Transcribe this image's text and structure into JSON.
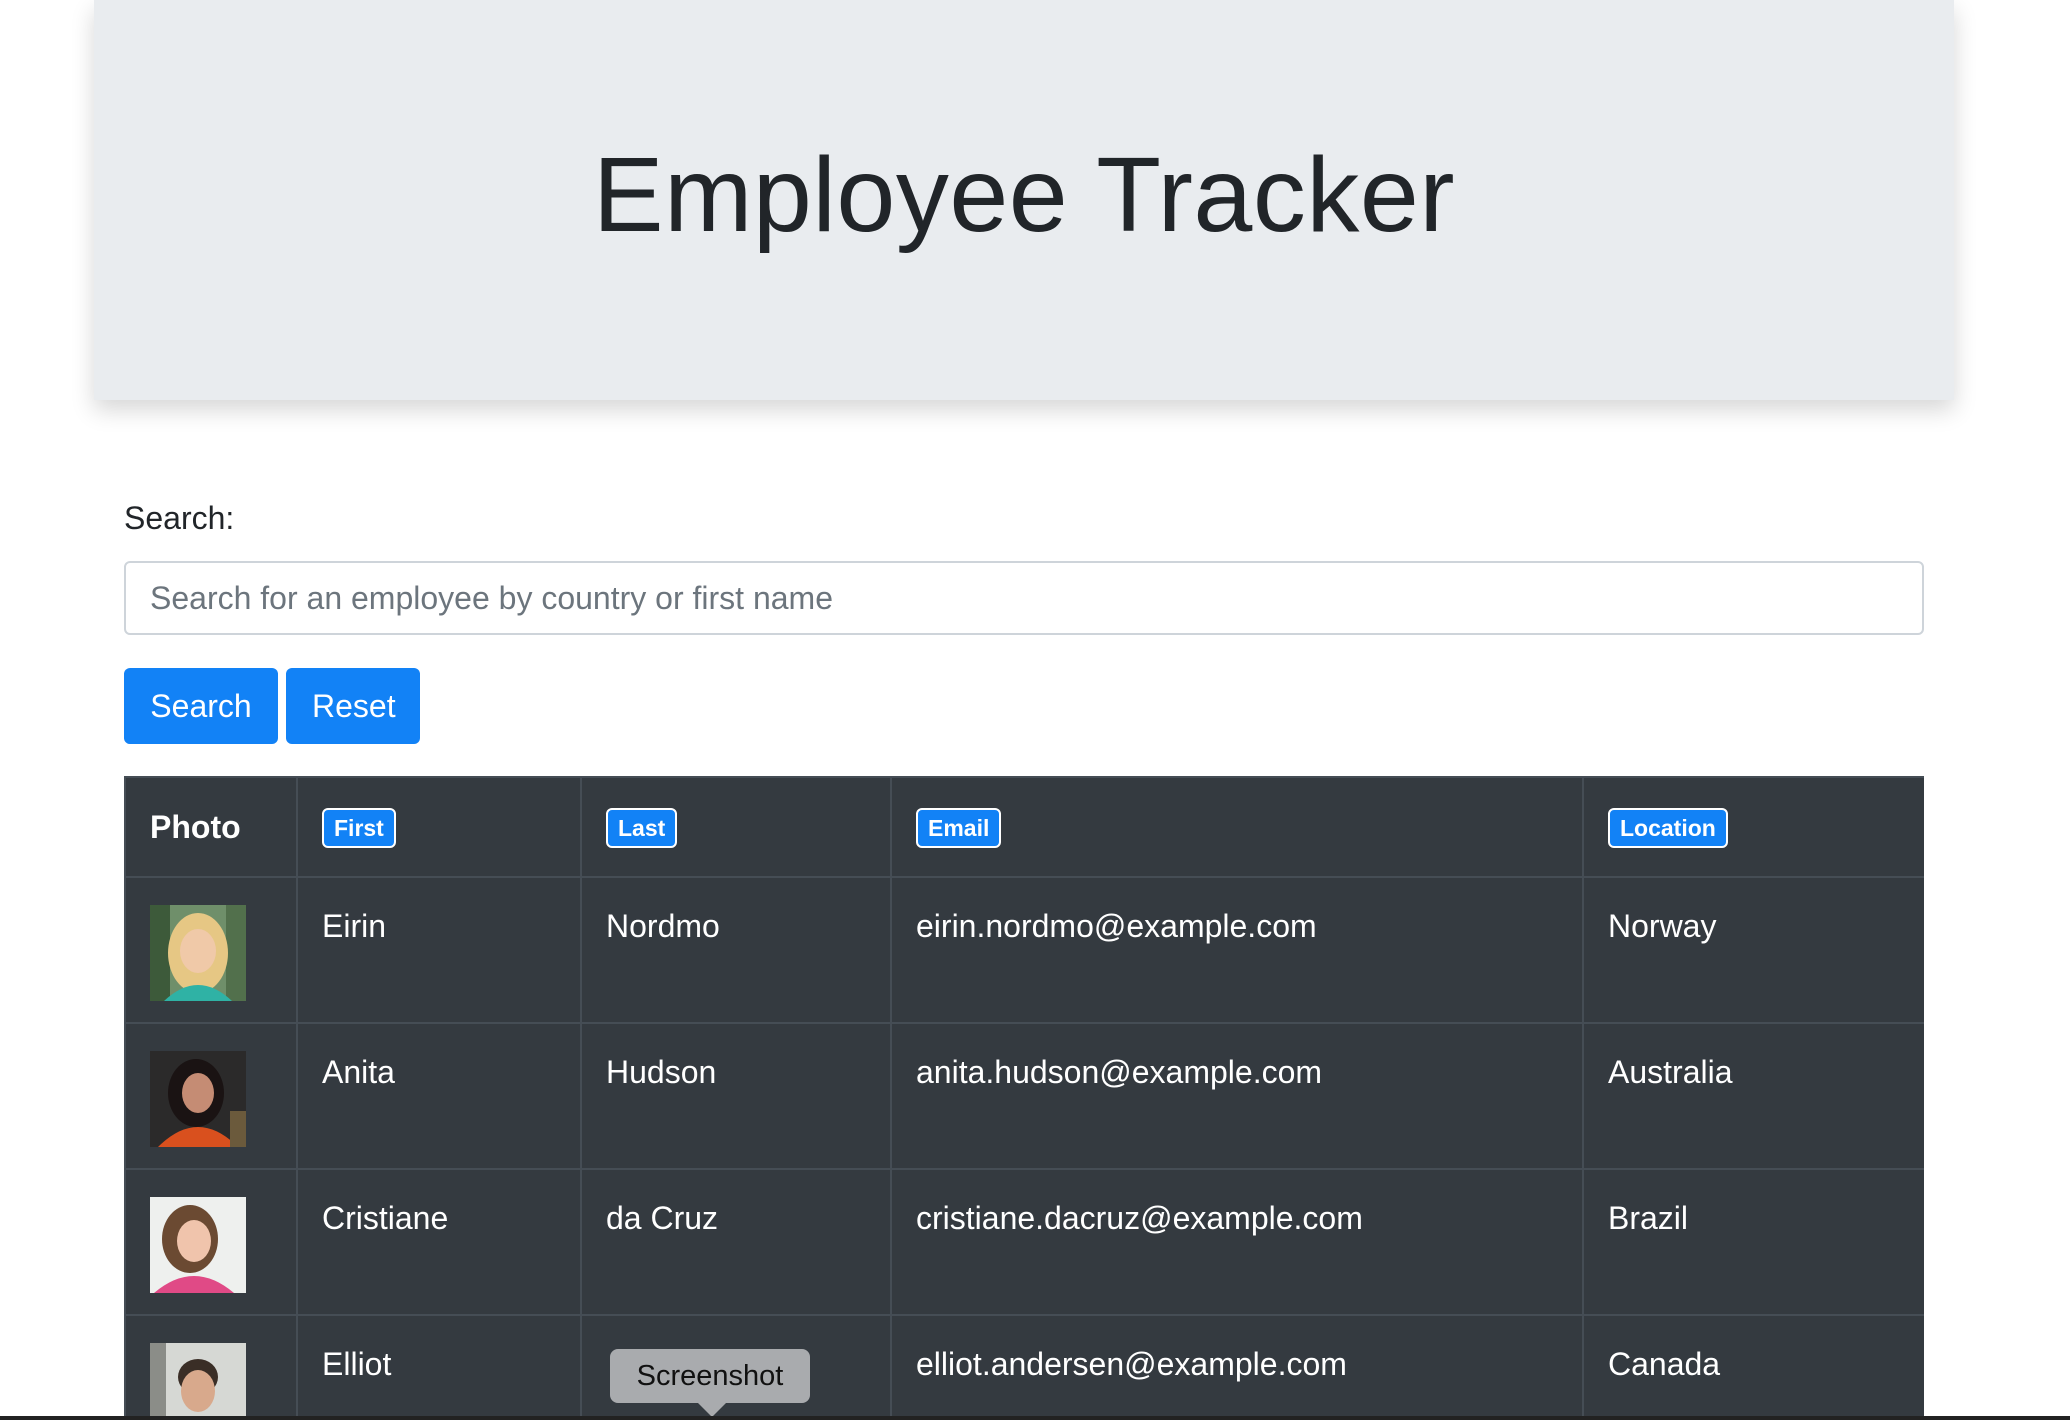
{
  "header": {
    "title": "Employee Tracker"
  },
  "search": {
    "label": "Search:",
    "placeholder": "Search for an employee by country or first name",
    "value": ""
  },
  "buttons": {
    "search_label": "Search",
    "reset_label": "Reset"
  },
  "table": {
    "headers": {
      "photo": "Photo",
      "first": "First",
      "last": "Last",
      "email": "Email",
      "location": "Location"
    },
    "rows": [
      {
        "first": "Eirin",
        "last": "Nordmo",
        "email": "eirin.nordmo@example.com",
        "location": "Norway"
      },
      {
        "first": "Anita",
        "last": "Hudson",
        "email": "anita.hudson@example.com",
        "location": "Australia"
      },
      {
        "first": "Cristiane",
        "last": "da Cruz",
        "email": "cristiane.dacruz@example.com",
        "location": "Brazil"
      },
      {
        "first": "Elliot",
        "last": "",
        "email": "elliot.andersen@example.com",
        "location": "Canada"
      }
    ]
  },
  "tooltip": {
    "text": "Screenshot"
  },
  "colors": {
    "accent": "#1282f6",
    "table_bg": "#343a40",
    "jumbotron_bg": "#e9ecef"
  }
}
